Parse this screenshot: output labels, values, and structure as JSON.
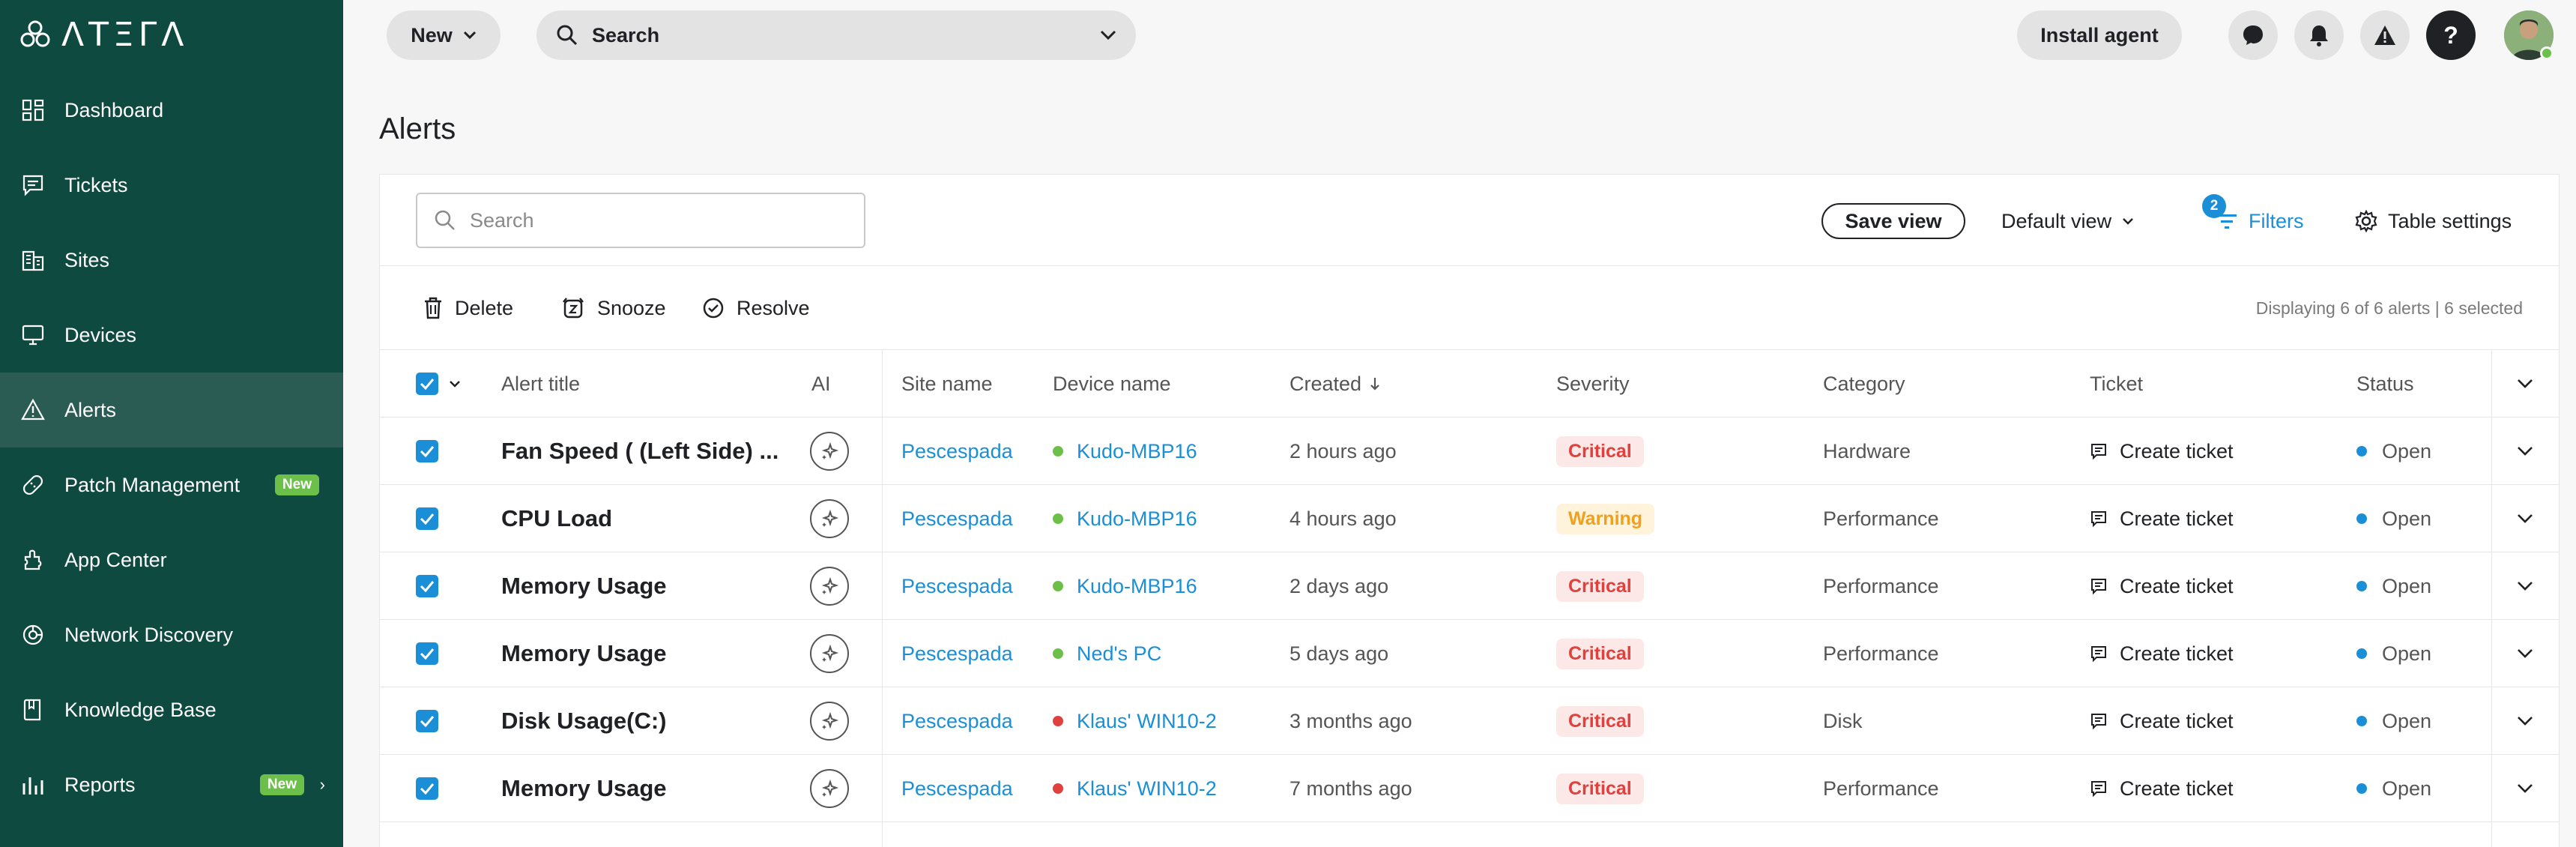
{
  "app": {
    "logo_text": "ΛΤΞΓΛ"
  },
  "sidebar": {
    "items": [
      {
        "label": "Dashboard",
        "icon": "dashboard-icon"
      },
      {
        "label": "Tickets",
        "icon": "tickets-icon"
      },
      {
        "label": "Sites",
        "icon": "sites-icon"
      },
      {
        "label": "Devices",
        "icon": "devices-icon"
      },
      {
        "label": "Alerts",
        "icon": "alert-triangle-icon",
        "active": true
      },
      {
        "label": "Patch Management",
        "icon": "patch-icon",
        "badge": "New"
      },
      {
        "label": "App Center",
        "icon": "app-center-icon"
      },
      {
        "label": "Network Discovery",
        "icon": "network-discovery-icon"
      },
      {
        "label": "Knowledge Base",
        "icon": "knowledge-base-icon"
      },
      {
        "label": "Reports",
        "icon": "reports-icon",
        "badge": "New",
        "chevron": true
      }
    ]
  },
  "topbar": {
    "new_label": "New",
    "search_label": "Search",
    "install_agent_label": "Install agent"
  },
  "page": {
    "title": "Alerts"
  },
  "toolbar": {
    "search_placeholder": "Search",
    "save_view_label": "Save view",
    "default_view_label": "Default view",
    "filters_label": "Filters",
    "filters_count": "2",
    "table_settings_label": "Table settings"
  },
  "actions": {
    "delete_label": "Delete",
    "snooze_label": "Snooze",
    "resolve_label": "Resolve",
    "displaying_text": "Displaying 6 of 6 alerts | 6 selected"
  },
  "table": {
    "columns": {
      "alert_title": "Alert title",
      "ai": "AI",
      "site_name": "Site name",
      "device_name": "Device name",
      "created": "Created",
      "severity": "Severity",
      "category": "Category",
      "ticket": "Ticket",
      "status": "Status"
    },
    "rows": [
      {
        "title": "Fan Speed ( (Left Side) ...",
        "site": "Pescespada",
        "device": "Kudo-MBP16",
        "device_status": "online",
        "created": "2 hours ago",
        "severity": "Critical",
        "category": "Hardware",
        "ticket": "Create ticket",
        "status": "Open"
      },
      {
        "title": "CPU Load",
        "site": "Pescespada",
        "device": "Kudo-MBP16",
        "device_status": "online",
        "created": "4 hours ago",
        "severity": "Warning",
        "category": "Performance",
        "ticket": "Create ticket",
        "status": "Open"
      },
      {
        "title": "Memory Usage",
        "site": "Pescespada",
        "device": "Kudo-MBP16",
        "device_status": "online",
        "created": "2 days ago",
        "severity": "Critical",
        "category": "Performance",
        "ticket": "Create ticket",
        "status": "Open"
      },
      {
        "title": "Memory Usage",
        "site": "Pescespada",
        "device": "Ned's PC",
        "device_status": "online",
        "created": "5 days ago",
        "severity": "Critical",
        "category": "Performance",
        "ticket": "Create ticket",
        "status": "Open"
      },
      {
        "title": "Disk Usage(C:)",
        "site": "Pescespada",
        "device": "Klaus' WIN10-2",
        "device_status": "offline",
        "created": "3 months ago",
        "severity": "Critical",
        "category": "Disk",
        "ticket": "Create ticket",
        "status": "Open"
      },
      {
        "title": "Memory Usage",
        "site": "Pescespada",
        "device": "Klaus' WIN10-2",
        "device_status": "offline",
        "created": "7 months ago",
        "severity": "Critical",
        "category": "Performance",
        "ticket": "Create ticket",
        "status": "Open"
      }
    ]
  },
  "colors": {
    "sidebar_bg": "#0f4a40",
    "accent": "#1a8fd8",
    "critical": "#e0413d",
    "warning": "#f1a01e",
    "online": "#6cc04a",
    "offline": "#e0413d"
  }
}
